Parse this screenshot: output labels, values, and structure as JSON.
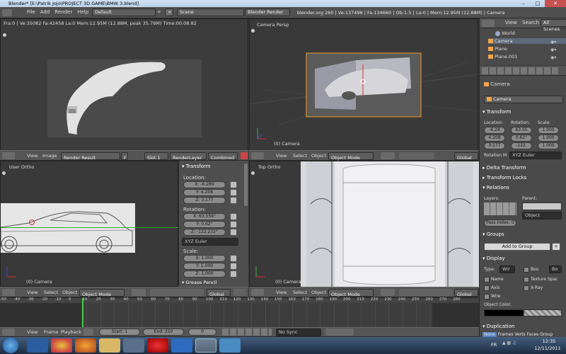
{
  "window": {
    "title": "Blender* [E:\\Patrik Jojo\\PROJECT 3D GAME\\BMW 3.blend]"
  },
  "topbar": {
    "menu": [
      "File",
      "Add",
      "Render",
      "Help"
    ],
    "layout": "Default",
    "scene": "Scene",
    "engine": "Blender Render",
    "stats": "blender.org 260 | Ve:137498 | Fa:134660 | Ob:1-5 | La:0 | Mem:12.95M (12.88M) | Camera"
  },
  "viewports": {
    "render": {
      "info": "Fra:0 | Ve:35082 Fa:42458 La:0 Mem:12.95M (12.88M, peak 35.79M) Time:00:08.82"
    },
    "camera": {
      "label": "Camera Persp",
      "object": "(0) Camera"
    },
    "user": {
      "label": "User Ortho",
      "object": "(0) Camera"
    },
    "top": {
      "label": "Top Ortho",
      "object": "(0) Camera"
    }
  },
  "image_header": {
    "view": "View",
    "image": "Image",
    "result": "Render Result",
    "f": "F",
    "slot": "Slot 1",
    "layer": "RenderLayer",
    "mode": "Combined"
  },
  "view3d_header": {
    "view": "View",
    "select": "Select",
    "object": "Object",
    "mode": "Object Mode",
    "orientation": "Global"
  },
  "transform_panel": {
    "title": "Transform",
    "location_label": "Location:",
    "loc": [
      "X: -6.289",
      "Y: 4.208",
      "Z: 3.177"
    ],
    "rotation_label": "Rotation:",
    "rot": [
      "X: 63.559°",
      "Y: 0.62°",
      "Z: -122.232°"
    ],
    "rotation_mode": "XYZ Euler",
    "scale_label": "Scale:",
    "scale": [
      "X: 1.000",
      "Y: 1.000",
      "Z: 1.000"
    ],
    "next_section": "Grease Pencil"
  },
  "outliner": {
    "view": "View",
    "search": "Search",
    "scenes": "All Scenes",
    "items": [
      "World",
      "Camera",
      "Plane",
      "Plane.001"
    ]
  },
  "properties": {
    "object_name": "Camera",
    "breadcrumb": "Camera",
    "transform": {
      "title": "Transform",
      "location": "Location:",
      "rotation": "Rotation:",
      "scale": "Scale:",
      "loc": [
        "-6.28",
        "4.208",
        "3.177"
      ],
      "rot": [
        "63.55",
        "0.62°",
        "-122."
      ],
      "scl": [
        "1.000",
        "1.000",
        "1.000"
      ],
      "rotation_mode_label": "Rotation M",
      "rotation_mode": "XYZ Euler"
    },
    "collapsed": [
      "Delta Transform",
      "Transform Locks"
    ],
    "relations": {
      "title": "Relations",
      "layers": "Layers:",
      "parent": "Parent:",
      "parent_type": "Object",
      "pass_index": "Pass Index: 0"
    },
    "groups": {
      "title": "Groups",
      "add": "Add to Group"
    },
    "display": {
      "title": "Display",
      "type_label": "Type:",
      "type": "Wir",
      "bounds": "Bou",
      "bounds_type": "Bo",
      "name": "Name",
      "axis": "Axis",
      "wire": "Wire",
      "texture_space": "Texture Spac",
      "xray": "X-Ray",
      "object_color": "Object Color:"
    },
    "duplication": {
      "title": "Duplication",
      "tabs": [
        "None",
        "Frames",
        "Verts",
        "Faces",
        "Group"
      ]
    }
  },
  "timeline": {
    "ticks": [
      "-50",
      "-40",
      "-30",
      "-20",
      "-10",
      "0",
      "10",
      "20",
      "30",
      "40",
      "50",
      "60",
      "70",
      "80",
      "90",
      "100",
      "110",
      "120",
      "130",
      "140",
      "150",
      "160",
      "170",
      "180",
      "190",
      "200",
      "210",
      "220",
      "230",
      "240",
      "250",
      "260",
      "270",
      "280"
    ],
    "current_frame": 1,
    "header": {
      "view": "View",
      "frame": "Frame",
      "playback": "Playback",
      "start": "Start: 1",
      "end": "End: 250",
      "current": "0",
      "sync": "No Sync"
    }
  },
  "taskbar": {
    "lang": "FR",
    "time": "12:35",
    "date": "12/11/2011"
  },
  "colors": {
    "selection": "#f09a2c",
    "blender_bg": "#393939",
    "header": "#555555"
  }
}
